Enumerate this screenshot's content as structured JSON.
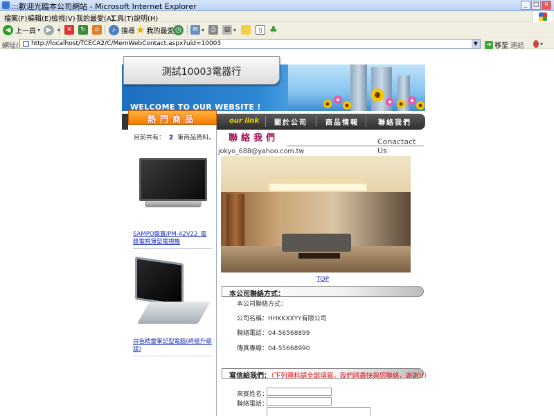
{
  "window": {
    "title": ":::歡迎光臨本公司網站 - Microsoft Internet Explorer",
    "minimize": "_",
    "maximize": "□",
    "close": "✕"
  },
  "menu": [
    "檔案(F)",
    "編輯(E)",
    "檢視(V)",
    "我的最愛(A)",
    "工具(T)",
    "說明(H)"
  ],
  "toolbar": {
    "back": "上一頁",
    "search": "搜尋",
    "favorites": "我的最愛"
  },
  "address": {
    "label": "網址(D)",
    "url": "http://localhost/TCECA2/C/MemWebContact.aspx?uid=10003",
    "go": "移至",
    "links": "連結"
  },
  "site": {
    "title": "測試10003電器行",
    "welcome": "WELCOME TO OUR WEBSITE !",
    "hot_title": "熱門商品",
    "nav_brand": "our link",
    "nav": [
      "關於公司",
      "商品情報",
      "聯絡我們"
    ]
  },
  "left": {
    "count_prefix": "目前共有：",
    "count": "2",
    "count_suffix": "筆商品資料。",
    "products": [
      {
        "name": "SAMPO聲寶/PM-42V22_電漿電視薄型電視機"
      },
      {
        "name": "白色精靈筆記型電腦(終極升級版)"
      }
    ]
  },
  "contact": {
    "heading": "聯絡我們",
    "heading_en": "Conactact Us",
    "email": "jokyo_688@yahoo.com.tw",
    "top": "TOP",
    "info_header": "本公司聯絡方式：",
    "info": [
      "本公司聯絡方式：",
      "公司名稱：HHKKXXYY有限公司",
      "聯絡電話：04-56568899",
      "傳真專線：04-55668990"
    ],
    "mail_header": "寫信給我們：",
    "mail_note": "（下列資料請全部填寫，我們將盡快與您聯絡，謝謝!!）",
    "form": {
      "name_label": "來賓姓名：",
      "phone_label": "聯絡電話："
    }
  }
}
